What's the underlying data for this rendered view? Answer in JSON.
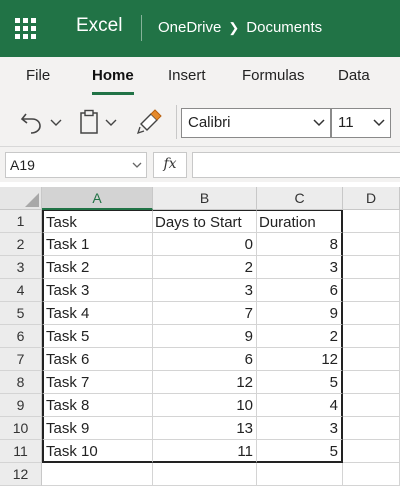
{
  "app": {
    "name": "Excel",
    "breadcrumb": [
      "OneDrive",
      "Documents"
    ]
  },
  "ribbon": {
    "tabs": [
      "File",
      "Home",
      "Insert",
      "Formulas",
      "Data"
    ],
    "active_tab": "Home"
  },
  "toolbar": {
    "icons": [
      "undo-icon",
      "paste-icon",
      "format-painter-icon"
    ],
    "font_name": "Calibri",
    "font_size": "11"
  },
  "formula_bar": {
    "name_box": "A19",
    "fx_label": "fx",
    "formula": ""
  },
  "sheet": {
    "columns": [
      "A",
      "B",
      "C",
      "D"
    ],
    "selected_column": "A",
    "row_numbers": [
      "1",
      "2",
      "3",
      "4",
      "5",
      "6",
      "7",
      "8",
      "9",
      "10",
      "11",
      "12"
    ],
    "header": [
      "Task",
      "Days to Start",
      "Duration"
    ],
    "rows": [
      {
        "task": "Task 1",
        "start": "0",
        "duration": "8"
      },
      {
        "task": "Task 2",
        "start": "2",
        "duration": "3"
      },
      {
        "task": "Task 3",
        "start": "3",
        "duration": "6"
      },
      {
        "task": "Task 4",
        "start": "7",
        "duration": "9"
      },
      {
        "task": "Task 5",
        "start": "9",
        "duration": "2"
      },
      {
        "task": "Task 6",
        "start": "6",
        "duration": "12"
      },
      {
        "task": "Task 7",
        "start": "12",
        "duration": "5"
      },
      {
        "task": "Task 8",
        "start": "10",
        "duration": "4"
      },
      {
        "task": "Task 9",
        "start": "13",
        "duration": "3"
      },
      {
        "task": "Task 10",
        "start": "11",
        "duration": "5"
      }
    ]
  },
  "colors": {
    "brand": "#217346",
    "ribbon_bg": "#f3f2f1"
  }
}
